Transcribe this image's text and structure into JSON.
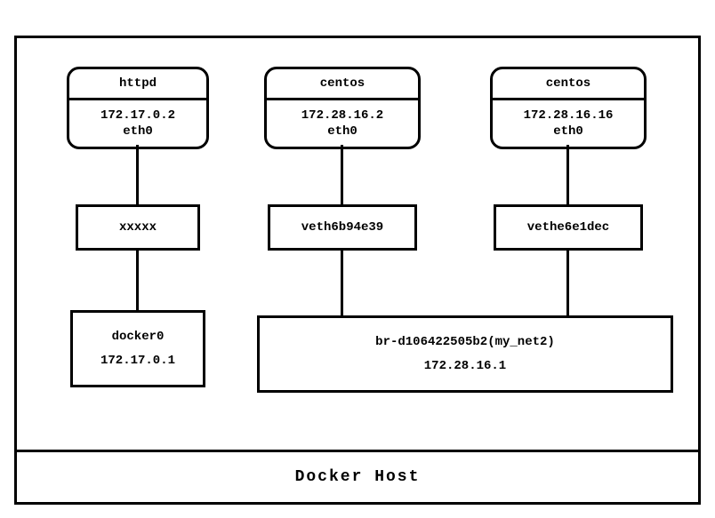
{
  "containers": {
    "c1": {
      "name": "httpd",
      "ip": "172.17.0.2",
      "iface": "eth0"
    },
    "c2": {
      "name": "centos",
      "ip": "172.28.16.2",
      "iface": "eth0"
    },
    "c3": {
      "name": "centos",
      "ip": "172.28.16.16",
      "iface": "eth0"
    }
  },
  "veths": {
    "v1": "xxxxx",
    "v2": "veth6b94e39",
    "v3": "vethe6e1dec"
  },
  "bridges": {
    "b1": {
      "name": "docker0",
      "ip": "172.17.0.1"
    },
    "b2": {
      "name": "br-d106422505b2(my_net2)",
      "ip": "172.28.16.1"
    }
  },
  "host": "Docker  Host"
}
